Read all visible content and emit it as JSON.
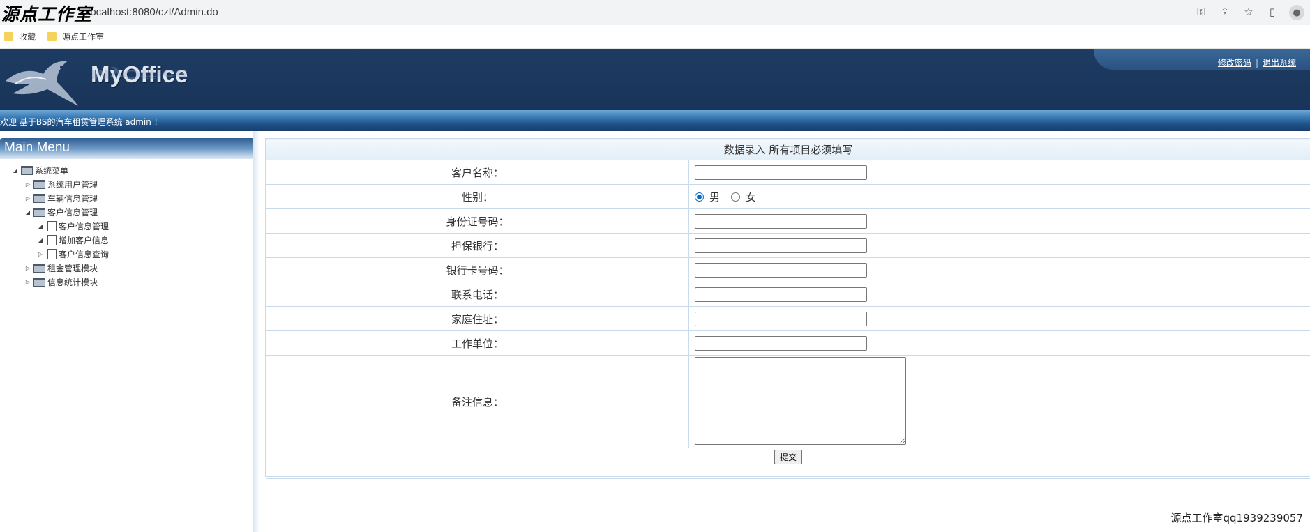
{
  "browser": {
    "url": "localhost:8080/czl/Admin.do",
    "watermark": "源点工作室",
    "bookmarks": [
      "收藏",
      "源点工作室"
    ]
  },
  "header": {
    "logo": "MyOffice",
    "links": {
      "change_password": "修改密码",
      "separator": "|",
      "logout": "退出系统"
    },
    "welcome": "欢迎 基于BS的汽车租赁管理系统 admin ！"
  },
  "sidebar": {
    "title": "Main Menu",
    "root": "系统菜单",
    "items": [
      {
        "label": "系统用户管理"
      },
      {
        "label": "车辆信息管理"
      },
      {
        "label": "客户信息管理",
        "children": [
          {
            "label": "客户信息管理"
          },
          {
            "label": "增加客户信息"
          },
          {
            "label": "客户信息查询"
          }
        ]
      },
      {
        "label": "租金管理模块"
      },
      {
        "label": "信息统计模块"
      }
    ]
  },
  "form": {
    "title": "数据录入  所有项目必须填写",
    "fields": {
      "name": "客户名称：",
      "gender": "性别：",
      "gender_male": "男",
      "gender_female": "女",
      "id_number": "身份证号码：",
      "bank": "担保银行：",
      "card": "银行卡号码：",
      "phone": "联系电话：",
      "address": "家庭住址：",
      "work": "工作单位：",
      "remark": "备注信息："
    },
    "submit": "提交"
  },
  "footer": {
    "watermark": "源点工作室qq1939239057"
  }
}
